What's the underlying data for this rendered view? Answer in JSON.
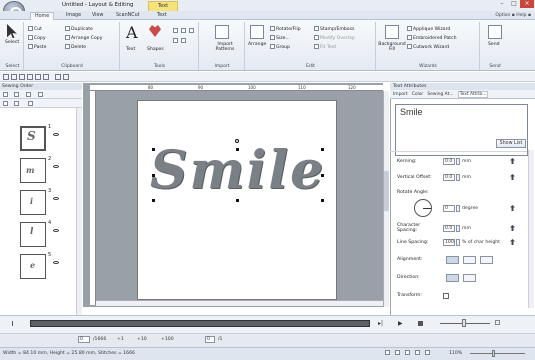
{
  "title": "Untitled - Layout & Editing",
  "context_tab": "Text",
  "tabs": [
    "Home",
    "Image",
    "View",
    "ScanNCut",
    "Text"
  ],
  "option_help": "Option  ▪  Help  ▪",
  "ribbon": {
    "select": "Select",
    "cut": "Cut",
    "copy": "Copy",
    "paste": "Paste",
    "duplicate": "Duplicate",
    "arrange_copy": "Arrange Copy",
    "delete": "Delete",
    "text": "Text",
    "shapes": "Shapes",
    "import_patterns": "Import Patterns",
    "arrange": "Arrange",
    "rotate_flip": "Rotate/Flip",
    "size": "Size...",
    "group": "Group",
    "stamp_emboss": "Stamp/Emboss",
    "modify_overlap": "Modify Overlap",
    "fit_text": "Fit Text",
    "background_fill": "Background Fill",
    "applique_wizard": "Applique Wizard",
    "embroidered_patch": "Embroidered Patch",
    "cutwork_wizard": "Cutwork Wizard",
    "send": "Send",
    "groups": [
      "Select",
      "Clipboard",
      "Tools",
      "Import",
      "Edit",
      "Wizards",
      "Send"
    ]
  },
  "sewing_order": {
    "title": "Sewing Order",
    "items": [
      {
        "num": "1",
        "letter": "S"
      },
      {
        "num": "2",
        "letter": "m"
      },
      {
        "num": "3",
        "letter": "i"
      },
      {
        "num": "4",
        "letter": "l"
      },
      {
        "num": "5",
        "letter": "e"
      }
    ]
  },
  "ruler_values": [
    "80",
    "90",
    "100",
    "110",
    "120"
  ],
  "canvas_text": "Smile",
  "attributes": {
    "panel_title": "Text Attributes",
    "tabs": [
      "Import",
      "Color",
      "Sewing At...",
      "Text Attrib..."
    ],
    "text_value": "Smile",
    "show_list": "Show List",
    "kerning_label": "Kerning:",
    "kerning_value": "0.0",
    "kerning_unit": "mm",
    "vertical_label": "Vertical Offset:",
    "vertical_value": "0.0",
    "vertical_unit": "mm",
    "rotate_label": "Rotate Angle:",
    "rotate_value": "0",
    "rotate_unit": "degree",
    "char_label": "Character Spacing:",
    "char_value": "0.0",
    "char_unit": "mm",
    "line_label": "Line Spacing:",
    "line_value": "100",
    "line_unit": "% of char height",
    "alignment_label": "Alignment:",
    "direction_label": "Direction:",
    "transform_label": "Transform:"
  },
  "bottom_bar": {
    "fields": [
      "0",
      "/1666",
      "+1",
      "+10",
      "+100",
      "0",
      "/1"
    ]
  },
  "status": {
    "text": "Width = 84.10 mm, Height = 25.80 mm, Stitches = 1666",
    "zoom": "110%"
  }
}
